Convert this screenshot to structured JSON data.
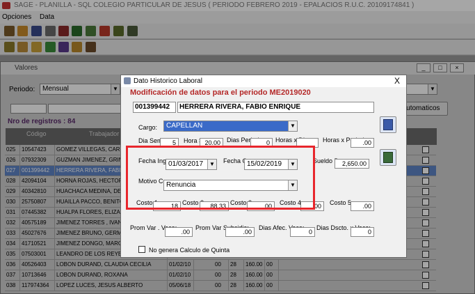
{
  "app": {
    "title": "SAGE - PLANILLA - SQL  COLEGIO PARTICULAR DE JESUS ( PERIODO FEBRERO 2019 - EPALACIOS  R.U.C. 20109174841 )",
    "menu": [
      "Opciones",
      "Data"
    ]
  },
  "valores_window": {
    "title": "Valores",
    "periodo_label": "Periodo:",
    "periodo_value": "Mensual",
    "registros_label": "Nro de registros : 84",
    "automaticos_label": "Automaticos",
    "columns": [
      "",
      "Código",
      "Trabajador"
    ],
    "rows": [
      {
        "n": "025",
        "code": "10547423",
        "name": "GOMEZ VILLEGAS, CAROL"
      },
      {
        "n": "026",
        "code": "07932309",
        "name": "GUZMAN JIMENEZ, GRIMI"
      },
      {
        "n": "027",
        "code": "001399442",
        "name": "HERRERA  RIVERA, FABI"
      },
      {
        "n": "028",
        "code": "42094104",
        "name": "HORNA ROJAS, HECTOR"
      },
      {
        "n": "029",
        "code": "40342810",
        "name": "HUACHACA MEDINA, DEN"
      },
      {
        "n": "030",
        "code": "25750807",
        "name": "HUAILLA PACCO, BENITO"
      },
      {
        "n": "031",
        "code": "07445382",
        "name": "HUALPA FLORES, ELIZAB"
      },
      {
        "n": "032",
        "code": "40575189",
        "name": "JIMENEZ  TORRES , IVAN"
      },
      {
        "n": "033",
        "code": "45027676",
        "name": "JIMENEZ BRUNO, GERMAI"
      },
      {
        "n": "034",
        "code": "41710521",
        "name": "JIMENEZ DONGO, MARGA"
      },
      {
        "n": "035",
        "code": "07503001",
        "name": "LEANDRO  DE LOS REYE"
      },
      {
        "n": "036",
        "code": "40526403",
        "name": "LOBON DURAND, CLAUDIA CECILIA"
      },
      {
        "n": "037",
        "code": "10713646",
        "name": "LOBON DURAND, ROXANA"
      },
      {
        "n": "038",
        "code": "117974364",
        "name": "LOPEZ LUCES, JESUS ALBERTO"
      }
    ],
    "visible_extra": [
      {
        "date": "01/02/10",
        "a": "00",
        "b": "28",
        "c": "160.00",
        "d": "00"
      },
      {
        "date": "01/02/10",
        "a": "00",
        "b": "28",
        "c": "160.00",
        "d": "00"
      },
      {
        "date": "05/06/18",
        "a": "00",
        "b": "28",
        "c": "160.00",
        "d": "00"
      }
    ],
    "selected_row": 2
  },
  "dialog": {
    "title": "Dato Historico Laboral",
    "heading": "Modificación de datos para el periodo ME2019020",
    "employee_code": "001399442",
    "employee_name": "HERRERA  RIVERA, FABIO ENRIQUE",
    "cargo_label": "Cargo:",
    "cargo_value": "CAPELLAN",
    "dia_label": "Dia Sem.:",
    "dia_value": "5",
    "hora_label": "Hora Sem.:",
    "hora_value": "20.00",
    "dias_periodo_label": "Dias Periodo:",
    "dias_periodo_value": "0",
    "horas_dia_label": "Horas x Dia:",
    "horas_dia_value": "",
    "horas_periodo_label": "Horas x Periodo:",
    "horas_periodo_value": ".00",
    "fecha_ingreso_label": "Fecha Ingreso:",
    "fecha_ingreso_value": "01/03/2017",
    "fecha_cese_label": "Fecha Cese:",
    "fecha_cese_value": "15/02/2019",
    "sueldo_label": "Sueldo Bruto:",
    "sueldo_value": "2,650.00",
    "motivo_label": "Motivo Cese",
    "motivo_value": "Renuncia",
    "costo1_label": "Costo 1:",
    "costo1_value": "18",
    "costo2_label": "Costo 2:",
    "costo2_value": "88.33",
    "costo3_label": "Costo 3:",
    "costo3_value": ".00",
    "costo4_label": "Costo 4:",
    "costo4_value": ".00",
    "costo5_label": "Costo 5:",
    "costo5_value": ".00",
    "prom_vaca_label": "Prom Var . Vaca:",
    "prom_vaca_value": ".00",
    "prom_subsidio_label": "Prom Var Subsidio:",
    "prom_subsidio_value": ".00",
    "dias_afec_label": "Dias Afec. Vaca:",
    "dias_afec_value": "0",
    "dias_dscto_label": "Dias Dscto. x Vaca:",
    "dias_dscto_value": "0",
    "quinta_label": "No genera Calculo de Quinta",
    "close_label": "X"
  },
  "colors": {
    "selected_row": "#5f84c6",
    "heading_red": "#b42828",
    "highlight_box": "#e8262c"
  }
}
